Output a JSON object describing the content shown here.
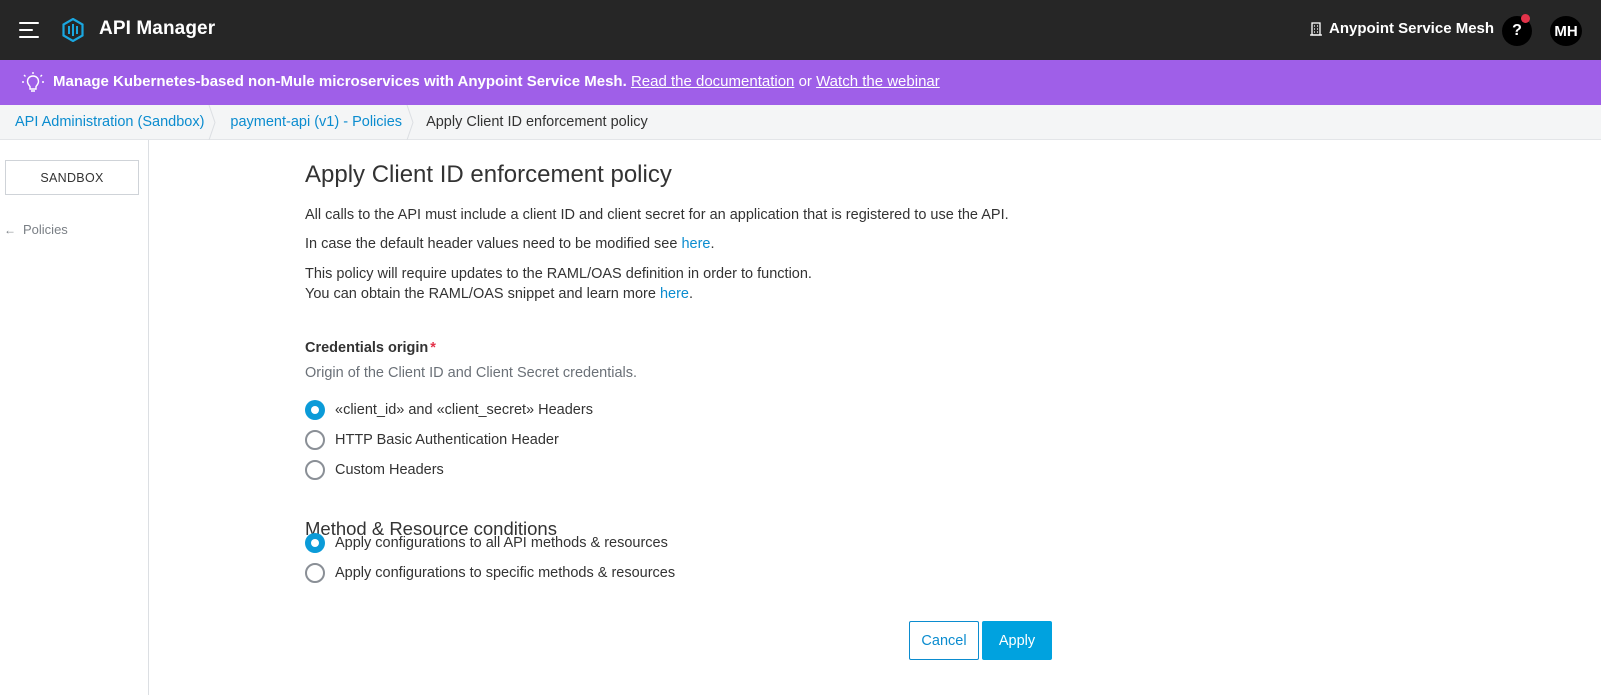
{
  "header": {
    "app_title": "API Manager",
    "menu_icon": "hamburger-menu-icon",
    "logo_icon": "api-manager-logo-icon",
    "service_mesh_label": "Anypoint Service Mesh",
    "service_mesh_icon": "building-icon",
    "help_label": "?",
    "avatar_initials": "MH"
  },
  "banner": {
    "icon": "lightbulb-icon",
    "message": "Manage Kubernetes-based non-Mule microservices with Anypoint Service Mesh.",
    "link_docs": "Read the documentation",
    "connector": "or",
    "link_webinar": "Watch the webinar",
    "background": "#9f5fe8"
  },
  "breadcrumb": {
    "items": [
      {
        "label": "API Administration (Sandbox)"
      },
      {
        "label": "payment-api (v1) - Policies"
      },
      {
        "label": "Apply Client ID enforcement policy"
      }
    ]
  },
  "sidebar": {
    "environment_label": "SANDBOX",
    "back_label": "Policies",
    "back_icon": "arrow-left-icon"
  },
  "main": {
    "title": "Apply Client ID enforcement policy",
    "intro": "All calls to the API must include a client ID and client secret for an application that is registered to use the API.",
    "header_note_prefix": "In case the default header values need to be modified see ",
    "header_note_link": "here",
    "header_note_suffix": ".",
    "raml_note_line1": "This policy will require updates to the RAML/OAS definition in order to function.",
    "raml_note_line2_prefix": "You can obtain the RAML/OAS snippet and learn more ",
    "raml_note_link": "here",
    "raml_note_suffix": ".",
    "credentials": {
      "label": "Credentials origin",
      "required_mark": "*",
      "description": "Origin of the Client ID and Client Secret credentials.",
      "options": [
        {
          "label": "«client_id» and «client_secret» Headers",
          "selected": true
        },
        {
          "label": "HTTP Basic Authentication Header",
          "selected": false
        },
        {
          "label": "Custom Headers",
          "selected": false
        }
      ]
    },
    "conditions": {
      "title": "Method & Resource conditions",
      "options": [
        {
          "label": "Apply configurations to all API methods & resources",
          "selected": true
        },
        {
          "label": "Apply configurations to specific methods & resources",
          "selected": false
        }
      ]
    },
    "actions": {
      "cancel": "Cancel",
      "apply": "Apply"
    }
  },
  "colors": {
    "accent": "#00a2df",
    "link": "#0b8ccf",
    "topbar": "#262626",
    "required": "#e3334a"
  }
}
